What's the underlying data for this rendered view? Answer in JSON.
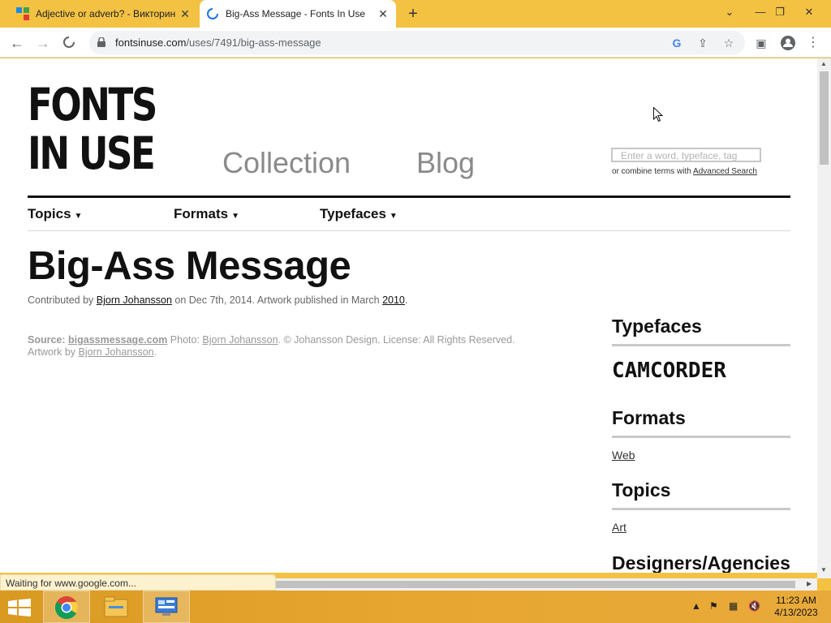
{
  "browser": {
    "tabs": [
      {
        "title": "Adjective or adverb? - Викторин",
        "active": false,
        "icon": "quiz-favicon-icon"
      },
      {
        "title": "Big-Ass Message - Fonts In Use",
        "active": true,
        "icon": "loading-spinner-icon"
      }
    ],
    "url_domain": "fontsinuse.com",
    "url_path": "/uses/7491/big-ass-message",
    "status_text": "Waiting for www.google.com..."
  },
  "site": {
    "logo_line1": "FONTS",
    "logo_line2": "IN USE",
    "nav": [
      "Collection",
      "Blog"
    ],
    "search_placeholder": "Enter a word, typeface, tag",
    "search_hint_prefix": "or combine terms with ",
    "search_hint_link": "Advanced Search",
    "subnav": [
      "Topics",
      "Formats",
      "Typefaces"
    ],
    "subnav_arrow": "▼"
  },
  "article": {
    "title": "Big-Ass Message",
    "meta_prefix": "Contributed by ",
    "contributor": "Bjorn Johansson",
    "meta_mid": " on Dec 7th, 2014. Artwork published in March ",
    "year": "2010",
    "meta_end": ".",
    "source_label": "Source:",
    "source_link": "bigassmessage.com",
    "photo_label": " Photo: ",
    "photo_link": "Bjorn Johansson",
    "rights": ". © Johansson Design. License: All Rights Reserved.",
    "artwork_label": "Artwork by ",
    "artwork_link": "Bjorn Johansson",
    "artwork_end": "."
  },
  "sidebar": {
    "typefaces_heading": "Typefaces",
    "typeface": "CAMCORDER",
    "formats_heading": "Formats",
    "format": "Web",
    "topics_heading": "Topics",
    "topic": "Art",
    "designers_heading": "Designers/Agencies"
  },
  "taskbar": {
    "time": "11:23 AM",
    "date": "4/13/2023"
  }
}
